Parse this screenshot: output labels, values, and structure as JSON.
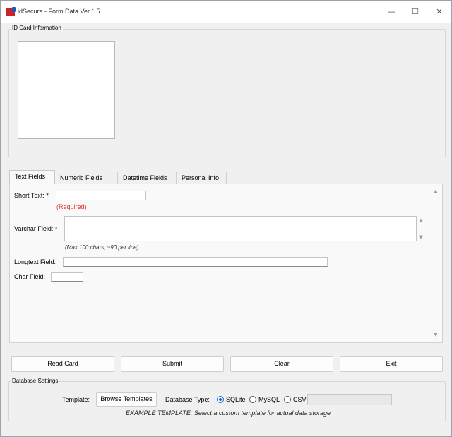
{
  "window": {
    "title": "idSecure - Form Data Ver.1.5",
    "icon": "id-app-icon",
    "controls": {
      "minimize": "—",
      "maximize": "☐",
      "close": "✕"
    }
  },
  "id_card_section": {
    "label": "ID Card Information"
  },
  "tabs": [
    {
      "label": "Text Fields",
      "active": true
    },
    {
      "label": "Numeric Fields",
      "active": false
    },
    {
      "label": "Datetime Fields",
      "active": false
    },
    {
      "label": "Personal Info",
      "active": false
    }
  ],
  "text_fields": {
    "short_text": {
      "label": "Short Text: *",
      "value": "",
      "error": "(Required)"
    },
    "varchar": {
      "label": "Varchar Field: *",
      "value": "",
      "hint": "(Max 100 chars, ~90 per line)"
    },
    "longtext": {
      "label": "Longtext Field:",
      "value": ""
    },
    "char": {
      "label": "Char Field:",
      "value": ""
    }
  },
  "actions": {
    "read_card": "Read Card",
    "submit": "Submit",
    "clear": "Clear",
    "exit": "Exit"
  },
  "database_settings": {
    "label": "Database Settings",
    "template_label": "Template:",
    "browse_button": "Browse Templates",
    "db_type_label": "Database Type:",
    "options": [
      {
        "label": "SQLite",
        "selected": true
      },
      {
        "label": "MySQL",
        "selected": false
      },
      {
        "label": "CSV",
        "selected": false
      }
    ],
    "csv_path": "",
    "note": "EXAMPLE TEMPLATE: Select a custom template for actual data storage"
  },
  "colors": {
    "required": "#e0302a",
    "accent": "#1a66c9",
    "logo_red": "#c8242a",
    "logo_blue": "#2456b8"
  }
}
